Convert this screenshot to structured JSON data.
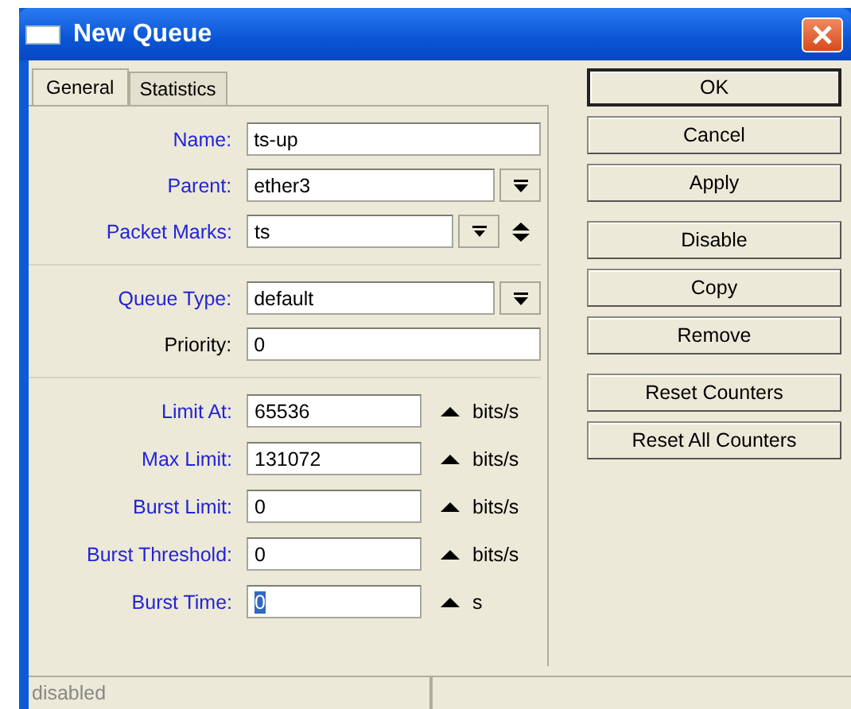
{
  "window": {
    "title": "New Queue"
  },
  "tabs": [
    {
      "label": "General",
      "selected": true
    },
    {
      "label": "Statistics",
      "selected": false
    }
  ],
  "sections": [
    {
      "fields": [
        {
          "kind": "text",
          "label": "Name:",
          "color": "#2323d8",
          "value": "ts-up",
          "value_selected": false
        },
        {
          "kind": "dropdown",
          "label": "Parent:",
          "color": "#2323d8",
          "value": "ether3",
          "value_selected": false
        },
        {
          "kind": "multi",
          "label": "Packet Marks:",
          "color": "#2323d8",
          "value": "ts",
          "value_selected": false
        }
      ]
    },
    {
      "fields": [
        {
          "kind": "dropdown",
          "label": "Queue Type:",
          "color": "#2323d8",
          "value": "default",
          "value_selected": false
        },
        {
          "kind": "text",
          "label": "Priority:",
          "color": "#000000",
          "value": "0",
          "value_selected": false
        }
      ]
    },
    {
      "fields": [
        {
          "kind": "unit",
          "label": "Limit At:",
          "color": "#2323d8",
          "value": "65536",
          "unit": "bits/s",
          "value_selected": false
        },
        {
          "kind": "unit",
          "label": "Max Limit:",
          "color": "#2323d8",
          "value": "131072",
          "unit": "bits/s",
          "value_selected": false
        },
        {
          "kind": "unit",
          "label": "Burst Limit:",
          "color": "#2323d8",
          "value": "0",
          "unit": "bits/s",
          "value_selected": false
        },
        {
          "kind": "unit",
          "label": "Burst Threshold:",
          "color": "#2323d8",
          "value": "0",
          "unit": "bits/s",
          "value_selected": false
        },
        {
          "kind": "unit",
          "label": "Burst Time:",
          "color": "#2323d8",
          "value": "0",
          "unit": "s",
          "value_selected": true
        }
      ]
    }
  ],
  "button_groups": [
    [
      {
        "label": "OK",
        "default": true
      },
      {
        "label": "Cancel",
        "default": false
      },
      {
        "label": "Apply",
        "default": false
      }
    ],
    [
      {
        "label": "Disable",
        "default": false
      },
      {
        "label": "Copy",
        "default": false
      },
      {
        "label": "Remove",
        "default": false
      }
    ],
    [
      {
        "label": "Reset Counters",
        "default": false
      },
      {
        "label": "Reset All Counters",
        "default": false
      }
    ]
  ],
  "status_bar": {
    "status": "disabled"
  }
}
